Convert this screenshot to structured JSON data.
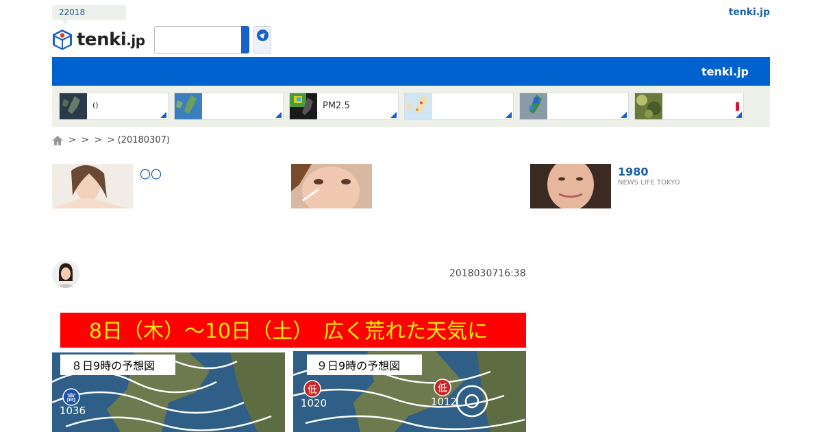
{
  "header": {
    "badge": "22018",
    "top_link": "tenki.jp",
    "logo_text": "tenki",
    "logo_suffix": ".jp"
  },
  "bluebar": {
    "brand": "tenki.jp"
  },
  "strip": {
    "cards": [
      {
        "label": "()"
      },
      {
        "label": ""
      },
      {
        "label": "PM2.5"
      },
      {
        "label": ""
      },
      {
        "label": ""
      },
      {
        "label": ""
      }
    ]
  },
  "breadcrumb": {
    "sep1": ">",
    "sep2": ">",
    "sep3": ">",
    "sep4": ">",
    "last": "(20180307)"
  },
  "ads": [
    {
      "title": "〇〇",
      "source": ""
    },
    {
      "title": "",
      "source": ""
    },
    {
      "title": "1980",
      "source": "NEWS LIFE TOKYO"
    }
  ],
  "article": {
    "datetime": "2018030716:38"
  },
  "hero": {
    "headline": "8日（木）〜10日（土）　広く荒れた天気に",
    "map1_caption": "８日9時の予想図",
    "map2_caption": "９日9時の予想図",
    "high_label": "高",
    "high_value": "1036",
    "low1_label": "低",
    "low1_value": "1020",
    "low2_label": "低",
    "low2_value": "1012",
    "headline_bg": "#ff0000",
    "headline_color": "#ffee00"
  },
  "colors": {
    "accent": "#0062cf",
    "link": "#1b5fa8"
  }
}
